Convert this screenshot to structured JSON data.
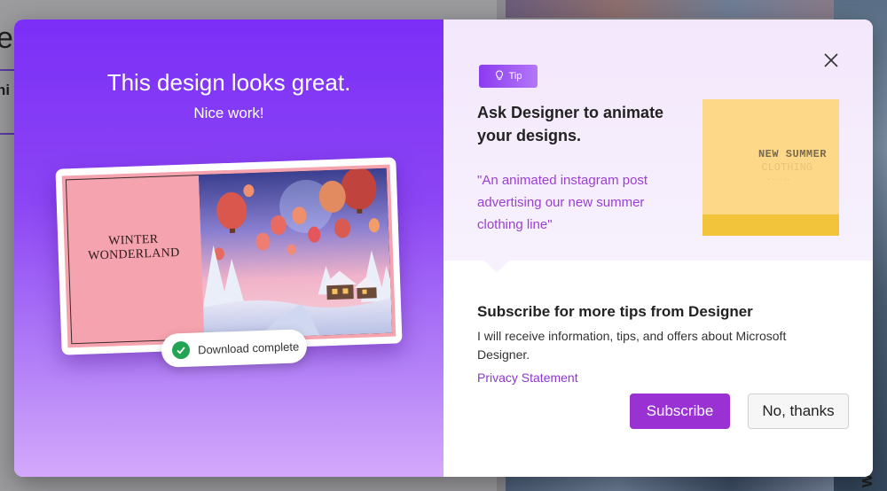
{
  "modal": {
    "headline": "This design looks great.",
    "subline": "Nice work!",
    "card": {
      "title": "WINTER WONDERLAND",
      "scene_icon": "hot-air-balloon-winter-scene-image"
    },
    "toast": {
      "text": "Download complete",
      "icon": "check-circle-icon"
    },
    "tip": {
      "badge_label": "Tip",
      "badge_icon": "lightbulb-icon",
      "heading": "Ask Designer to animate your designs.",
      "quote": "\"An animated instagram post advertising our new summer clothing line\"",
      "preview": {
        "title": "NEW SUMMER",
        "subtitle": "CLOTHING"
      }
    },
    "subscribe": {
      "heading": "Subscribe for more tips from Designer",
      "body": "I will receive information, tips, and offers about Microsoft Designer.",
      "privacy_link": "Privacy Statement",
      "subscribe_label": "Subscribe",
      "no_thanks_label": "No, thanks"
    },
    "close_icon": "close-icon"
  },
  "background": {
    "vertical_text": "WONDERLAND"
  },
  "colors": {
    "accent_purple": "#9a31d3",
    "left_gradient_top": "#7b2ff7",
    "left_gradient_bottom": "#d4a9fb",
    "card_pink": "#f5a3ae",
    "success_green": "#23a455",
    "link_purple": "#8e34d6"
  }
}
